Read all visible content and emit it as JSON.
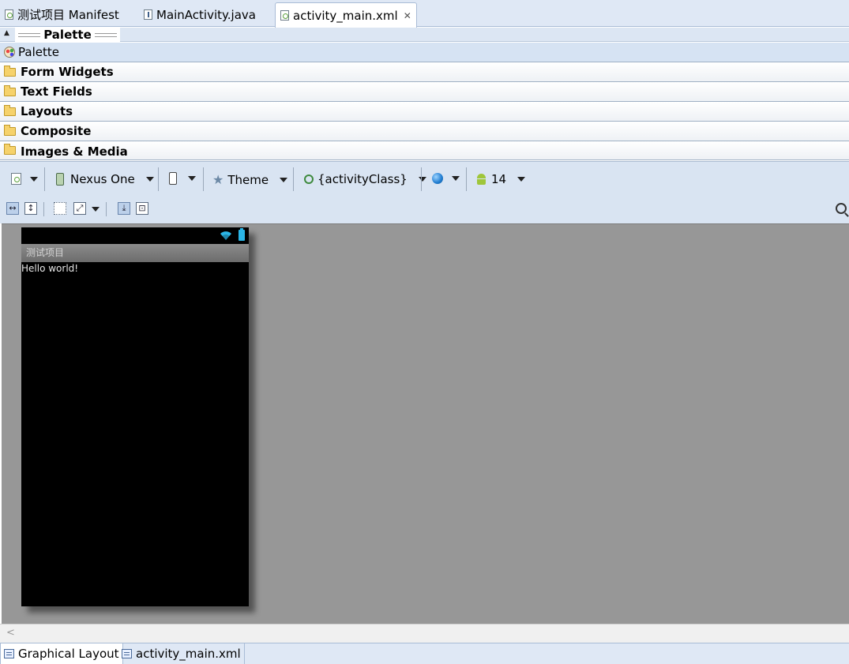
{
  "editor_tabs": [
    {
      "label": "测试项目 Manifest",
      "icon": "manifest-icon"
    },
    {
      "label": "MainActivity.java",
      "icon": "java-file-icon"
    },
    {
      "label": "activity_main.xml",
      "icon": "xml-file-icon",
      "active": true,
      "closable": true
    }
  ],
  "palette": {
    "header": "Palette",
    "root_label": "Palette",
    "categories": [
      "Form Widgets",
      "Text Fields",
      "Layouts",
      "Composite",
      "Images & Media"
    ]
  },
  "toolbar": {
    "device": "Nexus One",
    "theme": "Theme",
    "activity": "{activityClass}",
    "api_level": "14"
  },
  "device_preview": {
    "app_title": "测试项目",
    "content_text": "Hello world!",
    "status_color": "#2bb5e6"
  },
  "bottom_tabs": [
    {
      "label": "Graphical Layout",
      "active": true
    },
    {
      "label": "activity_main.xml"
    }
  ],
  "colors": {
    "canvas_bg": "#979797",
    "chrome_bg": "#d9e4f2",
    "device_bg": "#000000"
  }
}
